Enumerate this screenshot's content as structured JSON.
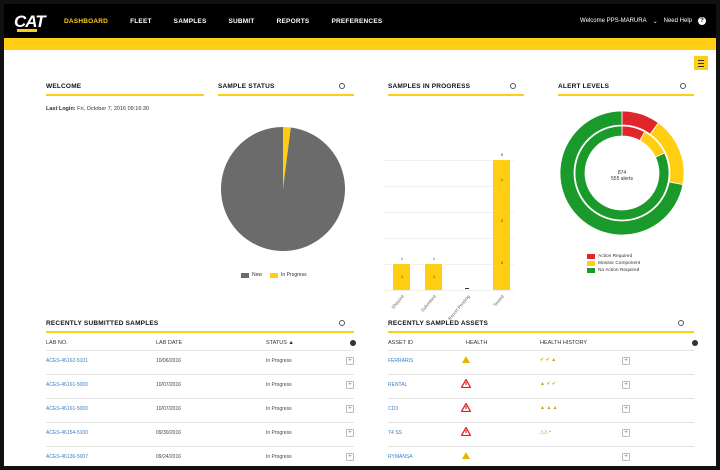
{
  "nav": {
    "logo": "CAT",
    "items": [
      "DASHBOARD",
      "FLEET",
      "SAMPLES",
      "SUBMIT",
      "REPORTS",
      "PREFERENCES"
    ],
    "active_index": 0,
    "user_label": "Welcome PPS-MARURA",
    "help_label": "Need Help"
  },
  "colors": {
    "accent": "#ffcd11",
    "gray": "#6b6b6b",
    "red": "#e0262a",
    "green": "#1a9a2a",
    "link": "#3b7fc4"
  },
  "welcome": {
    "title": "WELCOME",
    "last_login_label": "Last Login:",
    "last_login_value": "Fri, October 7, 2016 09:16:30"
  },
  "sample_status": {
    "title": "SAMPLE STATUS",
    "legend": [
      "New",
      "In Progress"
    ]
  },
  "samples_in_progress": {
    "title": "SAMPLES IN PROGRESS"
  },
  "alert_levels": {
    "title": "ALERT LEVELS",
    "center_line1": "874",
    "center_line2": "555 alerts",
    "legend": [
      "Action Required",
      "Monitor Component",
      "No Action Required"
    ]
  },
  "chart_data": [
    {
      "type": "pie",
      "categories": [
        "New",
        "In Progress"
      ],
      "values": [
        98,
        2
      ],
      "colors": [
        "#6b6b6b",
        "#ffcd11"
      ]
    },
    {
      "type": "bar",
      "categories": [
        "Shipped",
        "Submitted",
        "Report Pending",
        "Tested"
      ],
      "values": [
        1,
        1,
        0,
        5
      ],
      "data_labels": [
        "1",
        "1",
        "",
        "5"
      ],
      "inner_labels": [
        [
          "1"
        ],
        [
          "1"
        ],
        [],
        [
          "1",
          "2",
          "2"
        ]
      ],
      "ylim": [
        0,
        5
      ]
    },
    {
      "type": "pie",
      "categories": [
        "Action Required",
        "Monitor Component",
        "No Action Required"
      ],
      "series": [
        {
          "name": "outer",
          "values": [
            10,
            18,
            72
          ]
        },
        {
          "name": "inner",
          "values": [
            8,
            10,
            82
          ]
        }
      ],
      "colors": [
        "#e0262a",
        "#ffcd11",
        "#1a9a2a"
      ]
    }
  ],
  "recent_samples": {
    "title": "RECENTLY SUBMITTED SAMPLES",
    "headers": [
      "LAB NO.",
      "LAB DATE",
      "STATUS"
    ],
    "sort_arrow": "▲",
    "rows": [
      {
        "lab_no": "ACES-46162-5101",
        "date": "10/06/2016",
        "status": "In Progress"
      },
      {
        "lab_no": "ACES-46161-5000",
        "date": "10/07/2016",
        "status": "In Progress"
      },
      {
        "lab_no": "ACES-46161-5000",
        "date": "10/07/2016",
        "status": "In Progress"
      },
      {
        "lab_no": "ACES-46154-5100",
        "date": "09/30/2016",
        "status": "In Progress"
      },
      {
        "lab_no": "ACES-46136-5007",
        "date": "09/24/2016",
        "status": "In Progress"
      }
    ]
  },
  "recent_assets": {
    "title": "RECENTLY SAMPLED ASSETS",
    "headers": [
      "ASSET ID",
      "HEALTH",
      "HEALTH HISTORY"
    ],
    "rows": [
      {
        "asset_id": "FERRARIS",
        "health": "monitor",
        "history": "✔ ✔ ▲"
      },
      {
        "asset_id": "RENTAL",
        "health": "action",
        "history": "▲ ✔ ✔"
      },
      {
        "asset_id": "CD3",
        "health": "action",
        "history": "▲ ▲ ▲"
      },
      {
        "asset_id": "T4 SS",
        "health": "action",
        "history": "△△ ▪"
      },
      {
        "asset_id": "RYMANSA",
        "health": "monitor",
        "history": ""
      }
    ]
  }
}
